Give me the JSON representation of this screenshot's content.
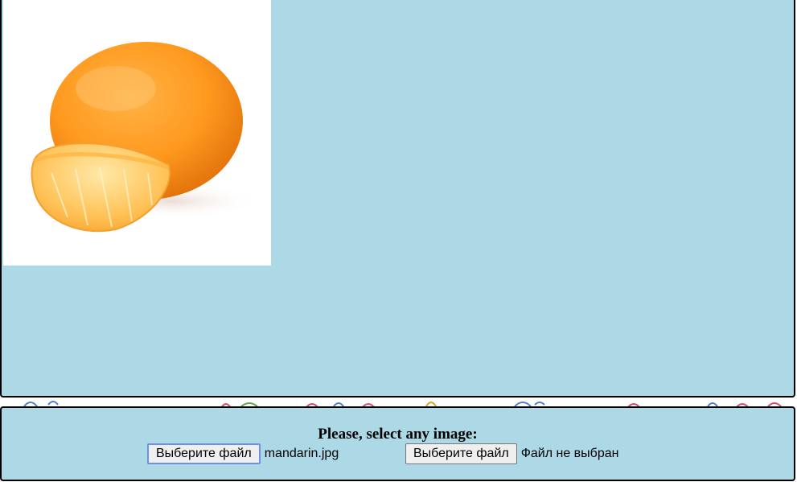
{
  "preview": {
    "image_alt": "mandarin"
  },
  "upload": {
    "prompt": "Please, select any image:",
    "inputs": [
      {
        "button_label": "Выберите файл",
        "file_name": "mandarin.jpg"
      },
      {
        "button_label": "Выберите файл",
        "file_name": "Файл не выбран"
      }
    ]
  },
  "colors": {
    "panel_background": "#add8e6",
    "panel_border": "#000000",
    "focus_ring": "#6f8fe0"
  },
  "icons": {
    "preview": "mandarin-image",
    "background": "floral-pattern"
  }
}
